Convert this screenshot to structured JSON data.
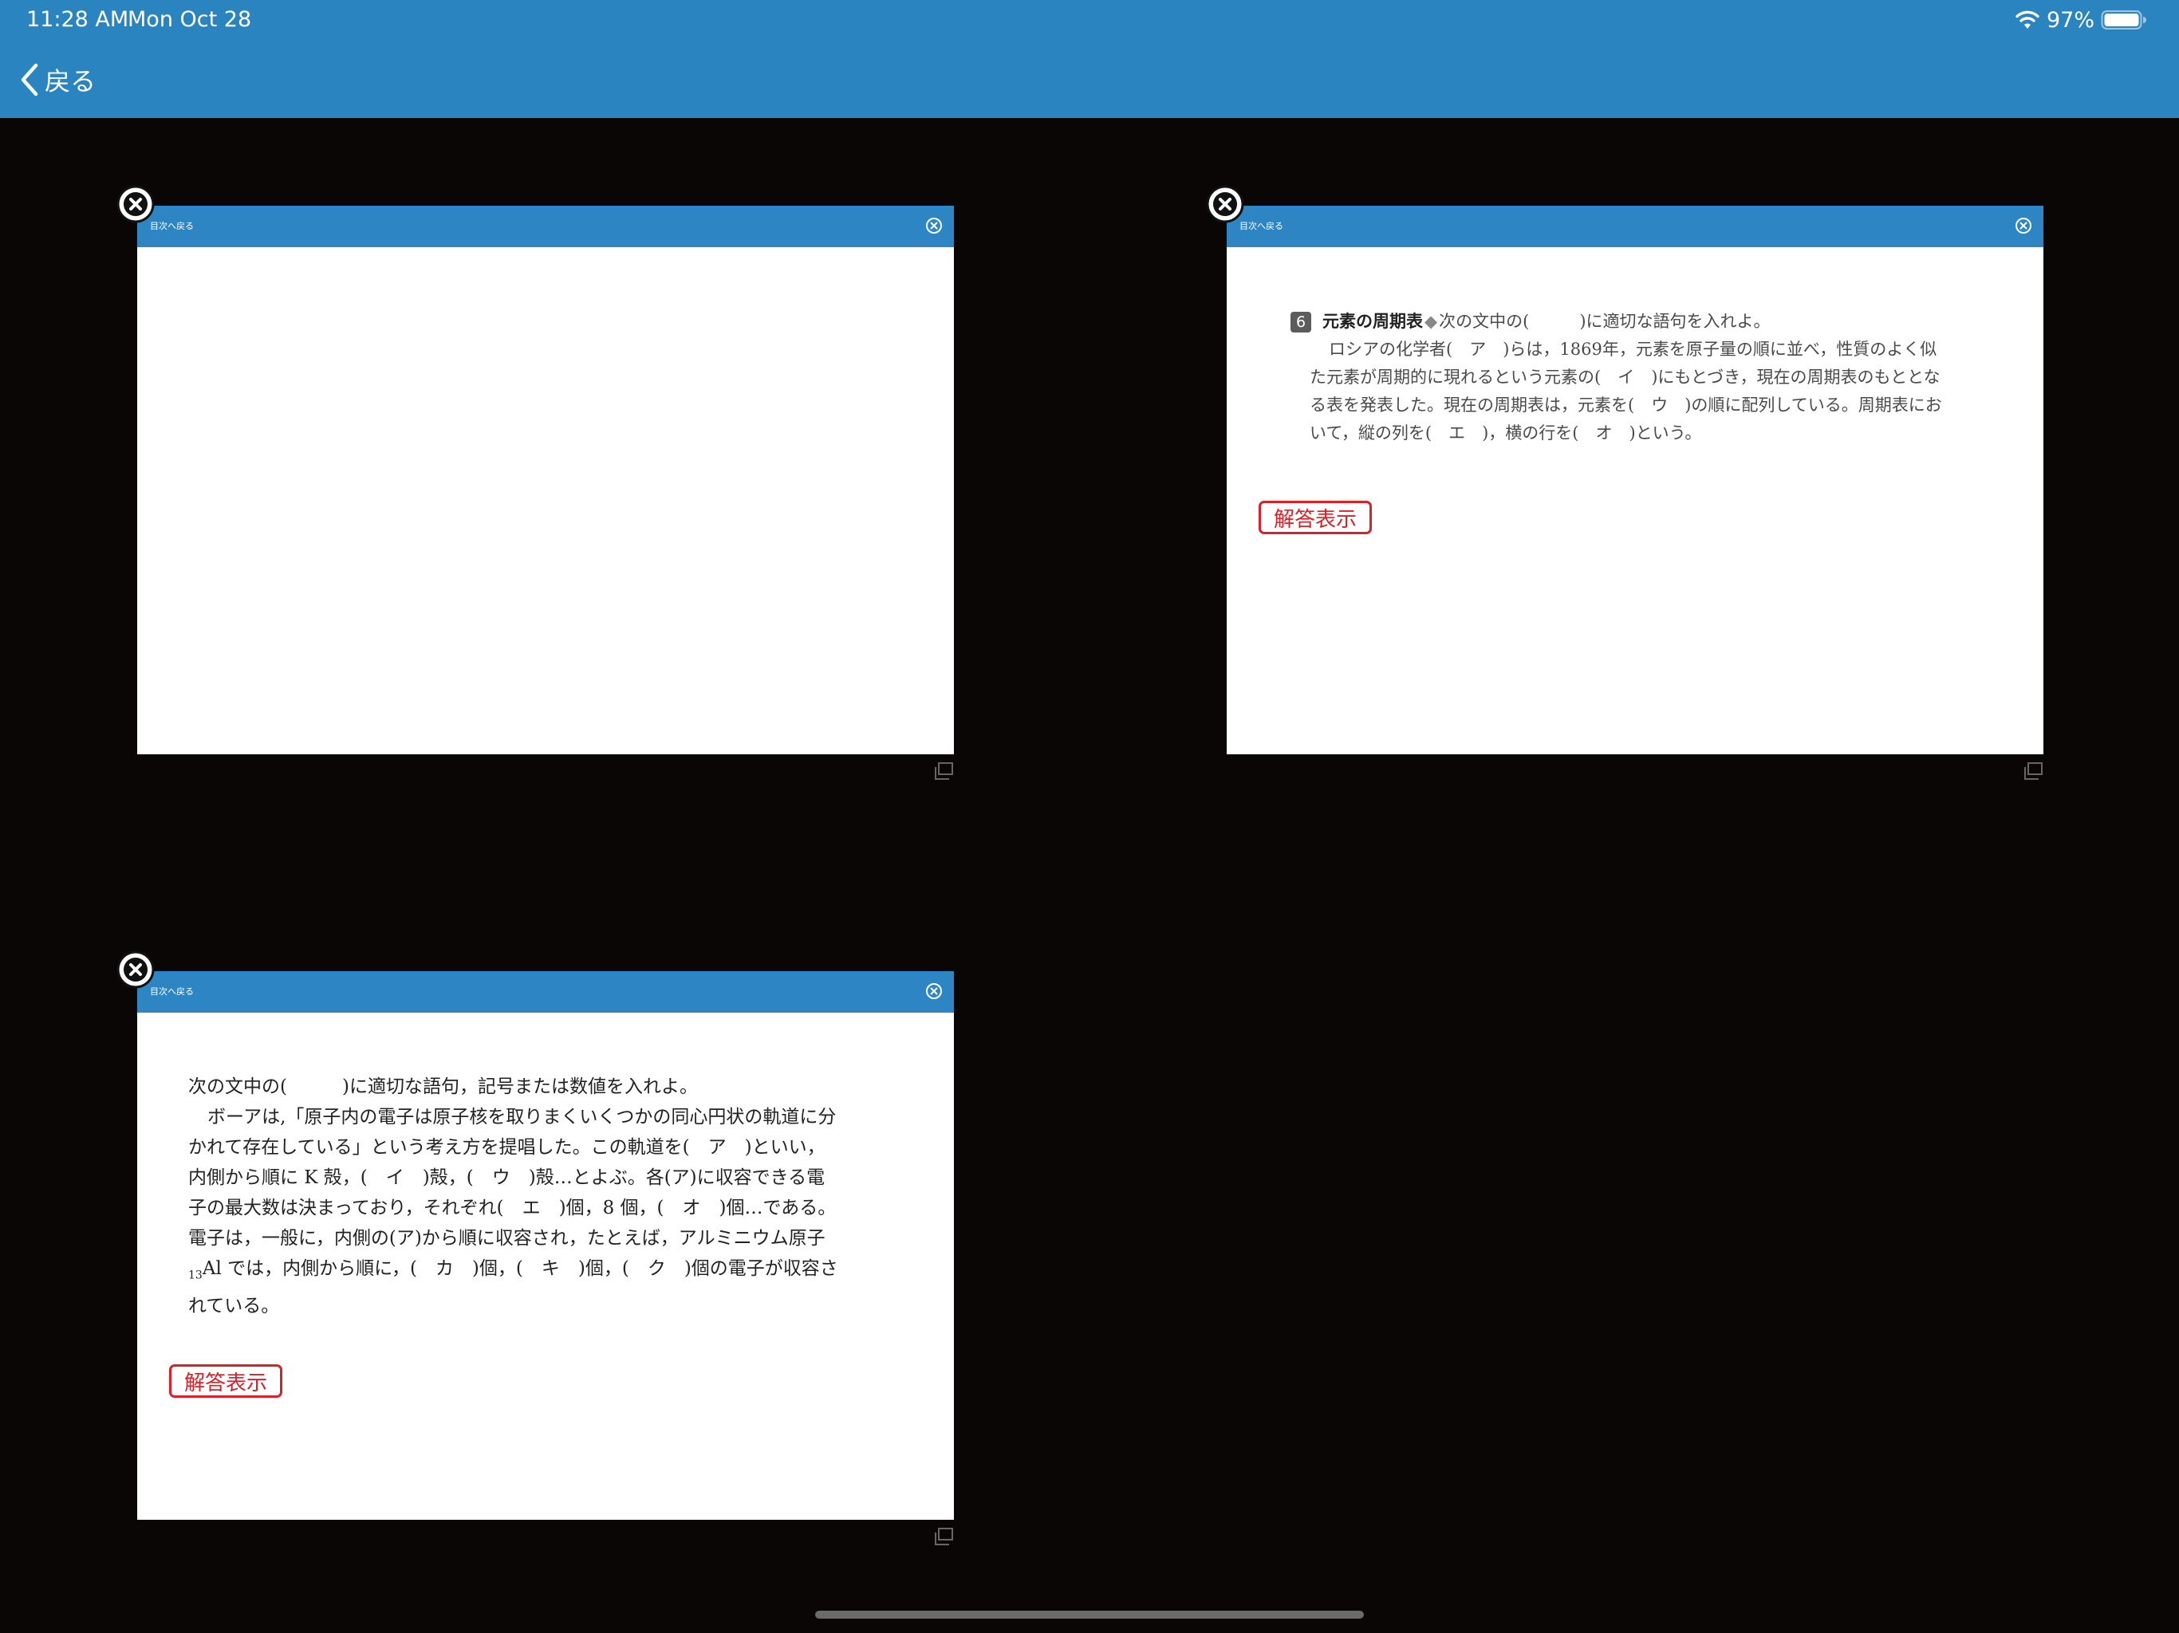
{
  "status_bar": {
    "time": "11:28 AM",
    "date": "Mon Oct 28",
    "battery": "97%"
  },
  "nav": {
    "back_label": "戻る"
  },
  "cards": [
    {
      "header_title": "目次へ戻る"
    },
    {
      "header_title": "目次へ戻る",
      "question": {
        "number": "6",
        "title": "元素の周期表",
        "separator": "◆",
        "prompt": "次の文中の(　　　)に適切な語句を入れよ。",
        "body": "ロシアの化学者(　ア　)らは，1869年，元素を原子量の順に並べ，性質のよく似た元素が周期的に現れるという元素の(　イ　)にもとづき，現在の周期表のもととなる表を発表した。現在の周期表は，元素を(　ウ　)の順に配列している。周期表において，縦の列を(　エ　)，横の行を(　オ　)という。"
      },
      "answer_button": "解答表示"
    },
    {
      "header_title": "目次へ戻る",
      "question": {
        "prompt": "次の文中の(　　　)に適切な語句，記号または数値を入れよ。",
        "body_before_sub": "ボーアは,「原子内の電子は原子核を取りまくいくつかの同心円状の軌道に分かれて存在している」という考え方を提唱した。この軌道を(　ア　)といい，内側から順に K 殻，(　イ　)殻，(　ウ　)殻…とよぶ。各(ア)に収容できる電子の最大数は決まっており，それぞれ(　エ　)個，8 個，(　オ　)個…である。電子は，一般に，内側の(ア)から順に収容され，たとえば，アルミニウム原子 ",
        "subscript": "13",
        "element": "Al",
        "body_after_sub": " では，内側から順に，(　カ　)個，(　キ　)個，(　ク　)個の電子が収容されている。"
      },
      "answer_button": "解答表示"
    }
  ],
  "colors": {
    "nav_blue": "#2a84c0",
    "header_blue": "#2e85c3",
    "answer_red": "#d82128",
    "background": "#0a0606"
  },
  "icons": {
    "back": "chevron-left-icon",
    "card_close": "close-circle-icon",
    "header_close": "close-circle-icon",
    "expand": "window-expand-icon",
    "wifi": "wifi-icon",
    "battery": "battery-icon"
  }
}
